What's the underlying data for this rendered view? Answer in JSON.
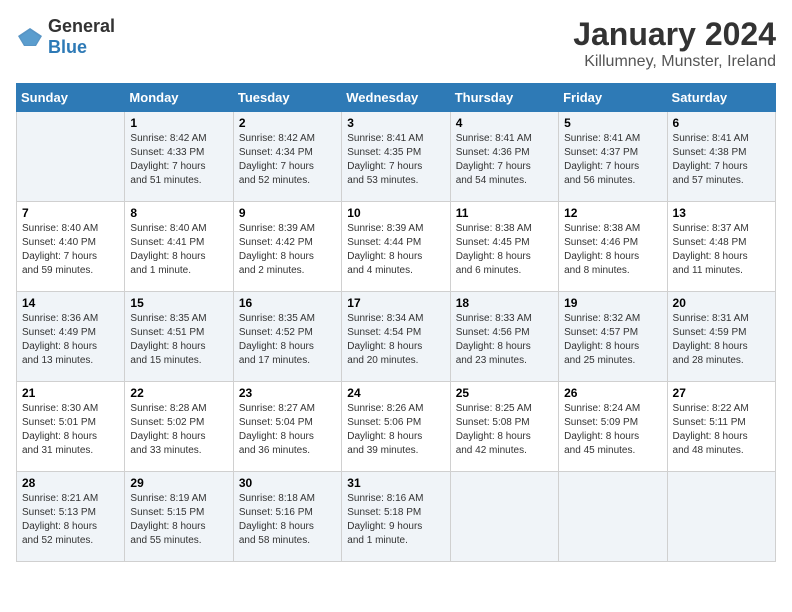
{
  "header": {
    "logo_general": "General",
    "logo_blue": "Blue",
    "month_title": "January 2024",
    "location": "Killumney, Munster, Ireland"
  },
  "columns": [
    "Sunday",
    "Monday",
    "Tuesday",
    "Wednesday",
    "Thursday",
    "Friday",
    "Saturday"
  ],
  "weeks": [
    [
      {
        "day": "",
        "info": ""
      },
      {
        "day": "1",
        "info": "Sunrise: 8:42 AM\nSunset: 4:33 PM\nDaylight: 7 hours\nand 51 minutes."
      },
      {
        "day": "2",
        "info": "Sunrise: 8:42 AM\nSunset: 4:34 PM\nDaylight: 7 hours\nand 52 minutes."
      },
      {
        "day": "3",
        "info": "Sunrise: 8:41 AM\nSunset: 4:35 PM\nDaylight: 7 hours\nand 53 minutes."
      },
      {
        "day": "4",
        "info": "Sunrise: 8:41 AM\nSunset: 4:36 PM\nDaylight: 7 hours\nand 54 minutes."
      },
      {
        "day": "5",
        "info": "Sunrise: 8:41 AM\nSunset: 4:37 PM\nDaylight: 7 hours\nand 56 minutes."
      },
      {
        "day": "6",
        "info": "Sunrise: 8:41 AM\nSunset: 4:38 PM\nDaylight: 7 hours\nand 57 minutes."
      }
    ],
    [
      {
        "day": "7",
        "info": "Sunrise: 8:40 AM\nSunset: 4:40 PM\nDaylight: 7 hours\nand 59 minutes."
      },
      {
        "day": "8",
        "info": "Sunrise: 8:40 AM\nSunset: 4:41 PM\nDaylight: 8 hours\nand 1 minute."
      },
      {
        "day": "9",
        "info": "Sunrise: 8:39 AM\nSunset: 4:42 PM\nDaylight: 8 hours\nand 2 minutes."
      },
      {
        "day": "10",
        "info": "Sunrise: 8:39 AM\nSunset: 4:44 PM\nDaylight: 8 hours\nand 4 minutes."
      },
      {
        "day": "11",
        "info": "Sunrise: 8:38 AM\nSunset: 4:45 PM\nDaylight: 8 hours\nand 6 minutes."
      },
      {
        "day": "12",
        "info": "Sunrise: 8:38 AM\nSunset: 4:46 PM\nDaylight: 8 hours\nand 8 minutes."
      },
      {
        "day": "13",
        "info": "Sunrise: 8:37 AM\nSunset: 4:48 PM\nDaylight: 8 hours\nand 11 minutes."
      }
    ],
    [
      {
        "day": "14",
        "info": "Sunrise: 8:36 AM\nSunset: 4:49 PM\nDaylight: 8 hours\nand 13 minutes."
      },
      {
        "day": "15",
        "info": "Sunrise: 8:35 AM\nSunset: 4:51 PM\nDaylight: 8 hours\nand 15 minutes."
      },
      {
        "day": "16",
        "info": "Sunrise: 8:35 AM\nSunset: 4:52 PM\nDaylight: 8 hours\nand 17 minutes."
      },
      {
        "day": "17",
        "info": "Sunrise: 8:34 AM\nSunset: 4:54 PM\nDaylight: 8 hours\nand 20 minutes."
      },
      {
        "day": "18",
        "info": "Sunrise: 8:33 AM\nSunset: 4:56 PM\nDaylight: 8 hours\nand 23 minutes."
      },
      {
        "day": "19",
        "info": "Sunrise: 8:32 AM\nSunset: 4:57 PM\nDaylight: 8 hours\nand 25 minutes."
      },
      {
        "day": "20",
        "info": "Sunrise: 8:31 AM\nSunset: 4:59 PM\nDaylight: 8 hours\nand 28 minutes."
      }
    ],
    [
      {
        "day": "21",
        "info": "Sunrise: 8:30 AM\nSunset: 5:01 PM\nDaylight: 8 hours\nand 31 minutes."
      },
      {
        "day": "22",
        "info": "Sunrise: 8:28 AM\nSunset: 5:02 PM\nDaylight: 8 hours\nand 33 minutes."
      },
      {
        "day": "23",
        "info": "Sunrise: 8:27 AM\nSunset: 5:04 PM\nDaylight: 8 hours\nand 36 minutes."
      },
      {
        "day": "24",
        "info": "Sunrise: 8:26 AM\nSunset: 5:06 PM\nDaylight: 8 hours\nand 39 minutes."
      },
      {
        "day": "25",
        "info": "Sunrise: 8:25 AM\nSunset: 5:08 PM\nDaylight: 8 hours\nand 42 minutes."
      },
      {
        "day": "26",
        "info": "Sunrise: 8:24 AM\nSunset: 5:09 PM\nDaylight: 8 hours\nand 45 minutes."
      },
      {
        "day": "27",
        "info": "Sunrise: 8:22 AM\nSunset: 5:11 PM\nDaylight: 8 hours\nand 48 minutes."
      }
    ],
    [
      {
        "day": "28",
        "info": "Sunrise: 8:21 AM\nSunset: 5:13 PM\nDaylight: 8 hours\nand 52 minutes."
      },
      {
        "day": "29",
        "info": "Sunrise: 8:19 AM\nSunset: 5:15 PM\nDaylight: 8 hours\nand 55 minutes."
      },
      {
        "day": "30",
        "info": "Sunrise: 8:18 AM\nSunset: 5:16 PM\nDaylight: 8 hours\nand 58 minutes."
      },
      {
        "day": "31",
        "info": "Sunrise: 8:16 AM\nSunset: 5:18 PM\nDaylight: 9 hours\nand 1 minute."
      },
      {
        "day": "",
        "info": ""
      },
      {
        "day": "",
        "info": ""
      },
      {
        "day": "",
        "info": ""
      }
    ]
  ]
}
